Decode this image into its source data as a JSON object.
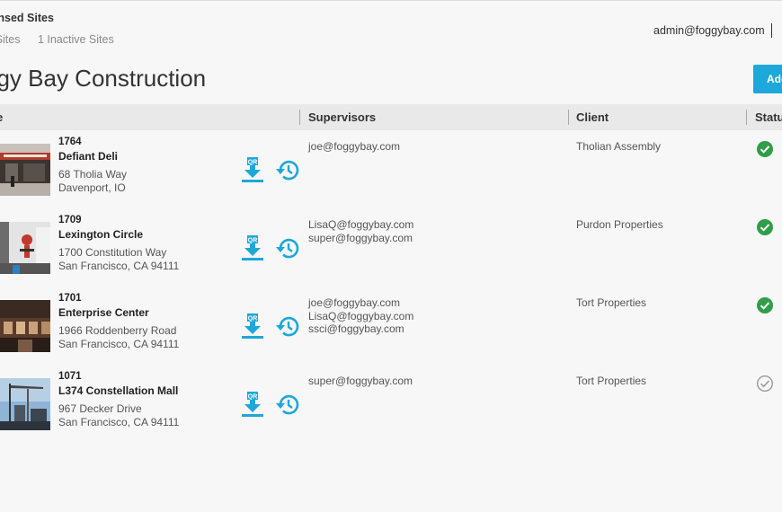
{
  "header": {
    "section_title": "icensed Sites",
    "active_sites": "ve Sites",
    "inactive_sites": "1 Inactive Sites",
    "user_email": "admin@foggybay.com",
    "company_name": "ggy Bay Construction",
    "add_button_label": "Add"
  },
  "table": {
    "columns": {
      "site": "e",
      "supervisors": "Supervisors",
      "client": "Client",
      "status": "Statu"
    },
    "rows": [
      {
        "id": "1764",
        "name": "Defiant Deli",
        "address1": "68 Tholia Way",
        "address2": "Davenport, IO",
        "supervisors": [
          "joe@foggybay.com"
        ],
        "client": "Tholian Assembly",
        "status": "active",
        "thumb_icon": "deli-storefront-photo"
      },
      {
        "id": "1709",
        "name": "Lexington Circle",
        "address1": "1700 Constitution Way",
        "address2": "San Francisco, CA 94111",
        "supervisors": [
          "LisaQ@foggybay.com",
          "super@foggybay.com"
        ],
        "client": "Purdon Properties",
        "status": "active",
        "thumb_icon": "building-wall-photo"
      },
      {
        "id": "1701",
        "name": "Enterprise Center",
        "address1": "1966 Roddenberry Road",
        "address2": "San Francisco, CA 94111",
        "supervisors": [
          "joe@foggybay.com",
          "LisaQ@foggybay.com",
          "ssci@foggybay.com"
        ],
        "client": "Tort Properties",
        "status": "active",
        "thumb_icon": "building-facade-photo"
      },
      {
        "id": "1071",
        "name": "L374 Constellation Mall",
        "address1": "967 Decker Drive",
        "address2": "San Francisco, CA 94111",
        "supervisors": [
          "super@foggybay.com"
        ],
        "client": "Tort Properties",
        "status": "inactive",
        "thumb_icon": "crane-site-photo"
      }
    ]
  },
  "icons": {
    "qr": "qr-download-icon",
    "history": "history-icon",
    "active": "check-circle-filled-icon",
    "inactive": "check-circle-outline-icon"
  },
  "colors": {
    "accent": "#1ea7d9",
    "status_active": "#2e9e48",
    "status_inactive": "#9a9a9a",
    "header_bg": "#e9e9e9"
  }
}
